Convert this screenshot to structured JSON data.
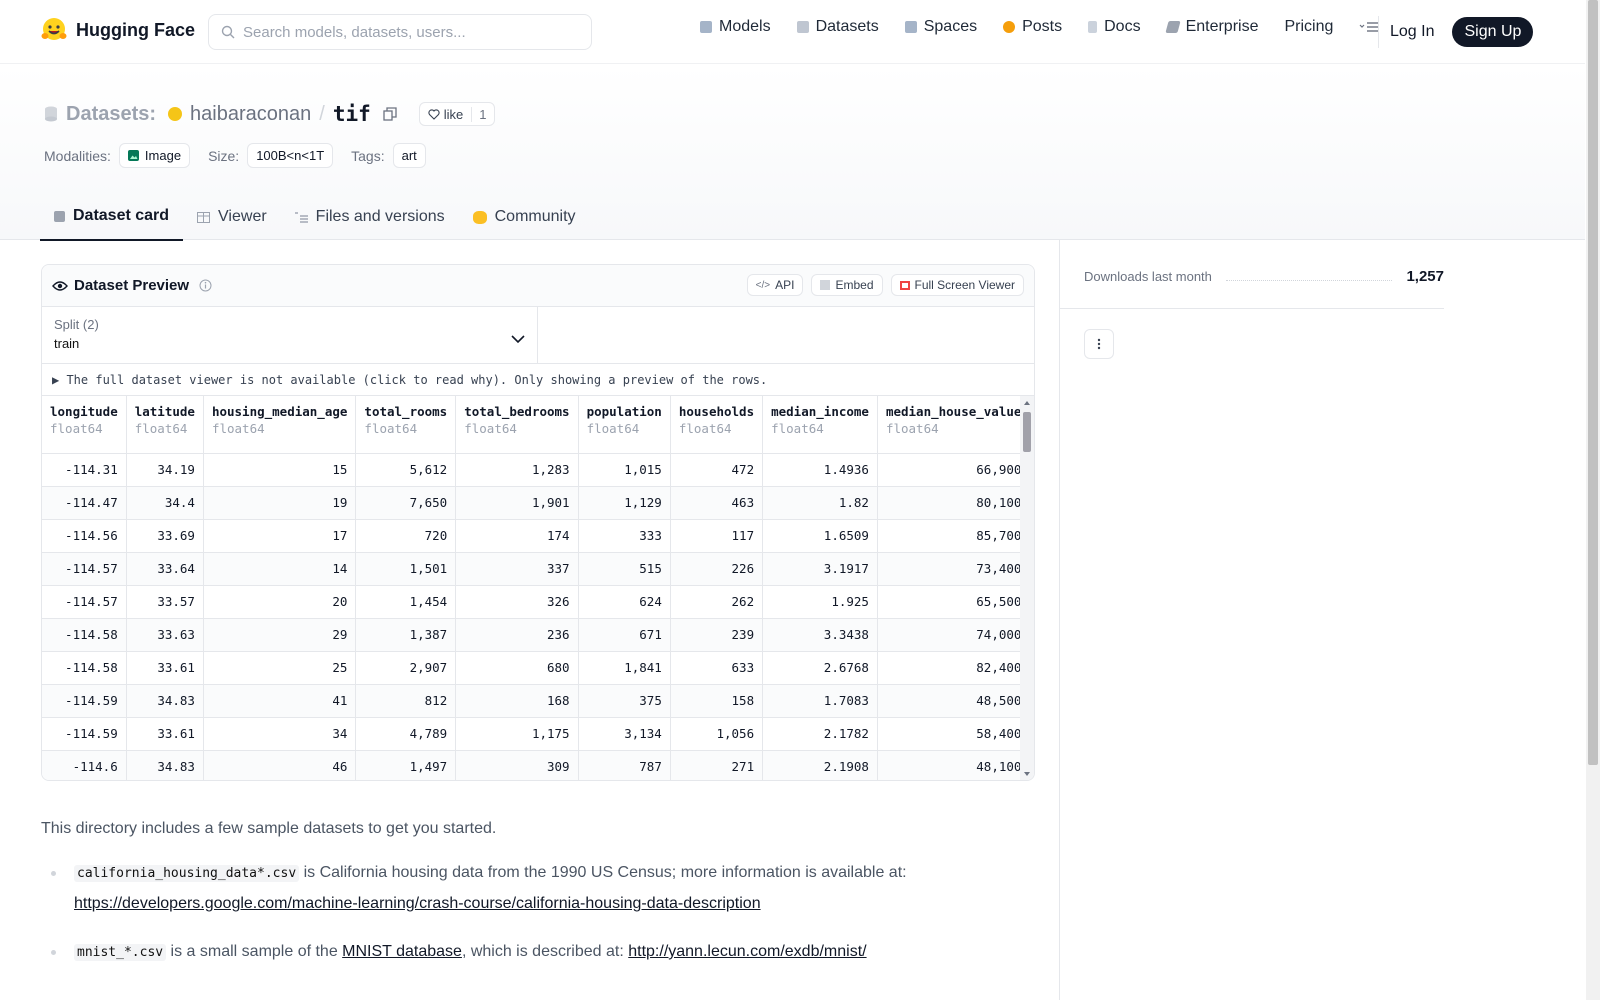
{
  "nav": {
    "logo_text": "Hugging Face",
    "search_placeholder": "Search models, datasets, users...",
    "links": [
      {
        "label": "Models",
        "icon": "cube-icon",
        "color": "#a5b4c8"
      },
      {
        "label": "Datasets",
        "icon": "database-icon",
        "color": "#bfc6d1"
      },
      {
        "label": "Spaces",
        "icon": "grid-icon",
        "color": "#a5b4c8"
      },
      {
        "label": "Posts",
        "icon": "dot-icon",
        "color": "#f59e0b"
      },
      {
        "label": "Docs",
        "icon": "doc-icon",
        "color": "#cbd2dc"
      },
      {
        "label": "Enterprise",
        "icon": "enterprise-icon",
        "color": "#9ca3af"
      },
      {
        "label": "Pricing",
        "icon": "",
        "color": ""
      }
    ],
    "login": "Log In",
    "signup": "Sign Up"
  },
  "header": {
    "datasets_label": "Datasets:",
    "owner": "haibaraconan",
    "slash": "/",
    "repo": "tif",
    "like_label": "like",
    "like_count": "1",
    "modalities_label": "Modalities:",
    "modality": "Image",
    "size_label": "Size:",
    "size": "100B<n<1T",
    "tags_label": "Tags:",
    "tag": "art"
  },
  "tabs": [
    {
      "label": "Dataset card"
    },
    {
      "label": "Viewer"
    },
    {
      "label": "Files and versions"
    },
    {
      "label": "Community"
    }
  ],
  "preview": {
    "title": "Dataset Preview",
    "api": "API",
    "embed": "Embed",
    "fullscreen": "Full Screen Viewer",
    "split_label": "Split (2)",
    "split_value": "train",
    "notice": "▶ The full dataset viewer is not available (click to read why). Only showing a preview of the rows.",
    "columns": [
      {
        "name": "longitude",
        "type": "float64"
      },
      {
        "name": "latitude",
        "type": "float64"
      },
      {
        "name": "housing_median_age",
        "type": "float64"
      },
      {
        "name": "total_rooms",
        "type": "float64"
      },
      {
        "name": "total_bedrooms",
        "type": "float64"
      },
      {
        "name": "population",
        "type": "float64"
      },
      {
        "name": "households",
        "type": "float64"
      },
      {
        "name": "median_income",
        "type": "float64"
      },
      {
        "name": "median_house_value",
        "type": "float64"
      }
    ],
    "rows": [
      [
        "-114.31",
        "34.19",
        "15",
        "5,612",
        "1,283",
        "1,015",
        "472",
        "1.4936",
        "66,900"
      ],
      [
        "-114.47",
        "34.4",
        "19",
        "7,650",
        "1,901",
        "1,129",
        "463",
        "1.82",
        "80,100"
      ],
      [
        "-114.56",
        "33.69",
        "17",
        "720",
        "174",
        "333",
        "117",
        "1.6509",
        "85,700"
      ],
      [
        "-114.57",
        "33.64",
        "14",
        "1,501",
        "337",
        "515",
        "226",
        "3.1917",
        "73,400"
      ],
      [
        "-114.57",
        "33.57",
        "20",
        "1,454",
        "326",
        "624",
        "262",
        "1.925",
        "65,500"
      ],
      [
        "-114.58",
        "33.63",
        "29",
        "1,387",
        "236",
        "671",
        "239",
        "3.3438",
        "74,000"
      ],
      [
        "-114.58",
        "33.61",
        "25",
        "2,907",
        "680",
        "1,841",
        "633",
        "2.6768",
        "82,400"
      ],
      [
        "-114.59",
        "34.83",
        "41",
        "812",
        "168",
        "375",
        "158",
        "1.7083",
        "48,500"
      ],
      [
        "-114.59",
        "33.61",
        "34",
        "4,789",
        "1,175",
        "3,134",
        "1,056",
        "2.1782",
        "58,400"
      ],
      [
        "-114.6",
        "34.83",
        "46",
        "1,497",
        "309",
        "787",
        "271",
        "2.1908",
        "48,100"
      ]
    ]
  },
  "card": {
    "intro": "This directory includes a few sample datasets to get you started.",
    "item1_code": "california_housing_data*.csv",
    "item1_text": " is California housing data from the 1990 US Census; more information is available at: ",
    "item1_link": "https://developers.google.com/machine-learning/crash-course/california-housing-data-description",
    "item2_code": "mnist_*.csv",
    "item2_text1": " is a small sample of the ",
    "item2_link1": "MNIST database",
    "item2_text2": ", which is described at: ",
    "item2_link2": "http://yann.lecun.com/exdb/mnist/"
  },
  "sidebar": {
    "downloads_label": "Downloads last month",
    "downloads_count": "1,257"
  }
}
